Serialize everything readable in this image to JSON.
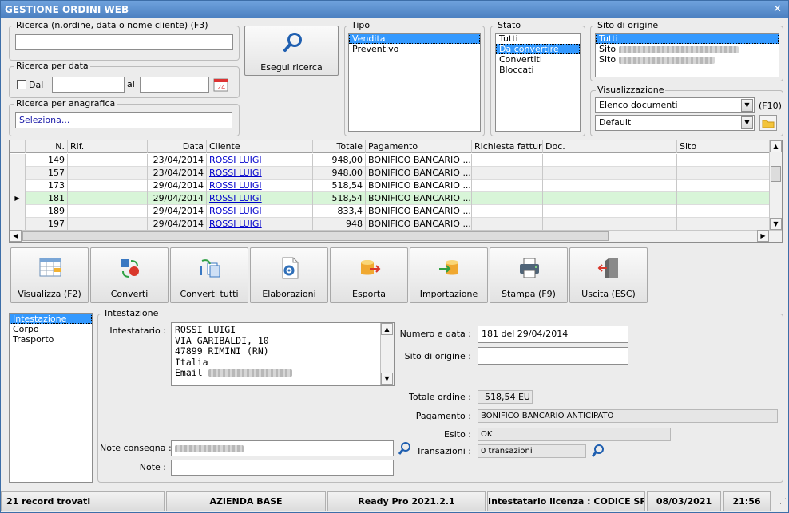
{
  "window": {
    "title": "GESTIONE ORDINI WEB",
    "close": "✕"
  },
  "search": {
    "legend": "Ricerca (n.ordine, data o nome cliente) (F3)",
    "value": "",
    "button_label": "Esegui ricerca"
  },
  "date_search": {
    "legend": "Ricerca per data",
    "dal_label": "Dal",
    "al_label": "al",
    "dal_value": "",
    "al_value": ""
  },
  "anagrafica": {
    "legend": "Ricerca per anagrafica",
    "value": "Seleziona..."
  },
  "tipo": {
    "legend": "Tipo",
    "items": [
      "Vendita",
      "Preventivo"
    ],
    "selected": 0
  },
  "stato": {
    "legend": "Stato",
    "items": [
      "Tutti",
      "Da convertire",
      "Convertiti",
      "Bloccati"
    ],
    "selected": 1
  },
  "sito_origine": {
    "legend": "Sito di origine",
    "items": [
      "Tutti",
      "Sito",
      "Sito"
    ],
    "selected": 0
  },
  "visualizzazione": {
    "legend": "Visualizzazione",
    "combo1": "Elenco documenti",
    "combo1_hotkey": "(F10)",
    "combo2": "Default"
  },
  "grid": {
    "columns": [
      "N.",
      "Rif.",
      "Data",
      "Cliente",
      "Totale",
      "Pagamento",
      "Richiesta fattura",
      "Doc.",
      "Sito"
    ],
    "rows": [
      {
        "n": "149",
        "rif": "",
        "data": "23/04/2014",
        "cliente": "ROSSI LUIGI",
        "totale": "948,00",
        "pagamento": "BONIFICO BANCARIO ..."
      },
      {
        "n": "157",
        "rif": "",
        "data": "23/04/2014",
        "cliente": "ROSSI LUIGI",
        "totale": "948,00",
        "pagamento": "BONIFICO BANCARIO ..."
      },
      {
        "n": "173",
        "rif": "",
        "data": "29/04/2014",
        "cliente": "ROSSI LUIGI",
        "totale": "518,54",
        "pagamento": "BONIFICO BANCARIO ..."
      },
      {
        "n": "181",
        "rif": "",
        "data": "29/04/2014",
        "cliente": "ROSSI LUIGI",
        "totale": "518,54",
        "pagamento": "BONIFICO BANCARIO ..."
      },
      {
        "n": "189",
        "rif": "",
        "data": "29/04/2014",
        "cliente": "ROSSI LUIGI",
        "totale": "833,4",
        "pagamento": "BONIFICO BANCARIO ..."
      },
      {
        "n": "197",
        "rif": "",
        "data": "29/04/2014",
        "cliente": "ROSSI LUIGI",
        "totale": "948",
        "pagamento": "BONIFICO BANCARIO ..."
      }
    ],
    "current_row": 3
  },
  "toolbar": {
    "visualizza": "Visualizza (F2)",
    "converti": "Converti",
    "converti_tutti": "Converti tutti",
    "elaborazioni": "Elaborazioni",
    "esporta": "Esporta",
    "importazione": "Importazione",
    "stampa": "Stampa (F9)",
    "uscita": "Uscita (ESC)"
  },
  "sections": {
    "items": [
      "Intestazione",
      "Corpo",
      "Trasporto"
    ],
    "selected": 0
  },
  "detail": {
    "legend": "Intestazione",
    "intestatario_label": "Intestatario :",
    "intestatario_lines": [
      "ROSSI LUIGI",
      "VIA GARIBALDI, 10",
      "47899 RIMINI (RN)",
      "Italia",
      "Email"
    ],
    "numero_label": "Numero e data :",
    "numero_value": "181 del 29/04/2014",
    "sito_label": "Sito di origine :",
    "sito_value": "",
    "totale_label": "Totale ordine :",
    "totale_value": "518,54 EU",
    "pagamento_label": "Pagamento :",
    "pagamento_value": "BONIFICO BANCARIO ANTICIPATO",
    "esito_label": "Esito :",
    "esito_value": "OK",
    "transazioni_label": "Transazioni :",
    "transazioni_value": "0 transazioni",
    "note_consegna_label": "Note consegna :",
    "note_label": "Note :",
    "note_value": ""
  },
  "statusbar": {
    "records": "21 record trovati",
    "azienda": "AZIENDA BASE",
    "version": "Ready Pro 2021.2.1",
    "licenza": "Intestatario licenza : CODICE SRL",
    "date": "08/03/2021",
    "time": "21:56"
  }
}
